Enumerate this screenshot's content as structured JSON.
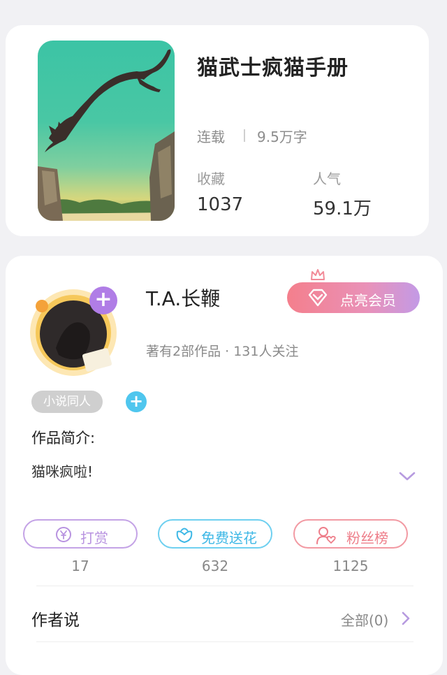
{
  "book": {
    "title": "猫武士疯猫手册",
    "status": "连载",
    "word_count": "9.5万字",
    "collect_label": "收藏",
    "collect_value": "1037",
    "popularity_label": "人气",
    "popularity_value": "59.1万"
  },
  "author": {
    "name": "T.A.长鞭",
    "vip_label": "点亮会员",
    "summary": "著有2部作品 · 131人关注",
    "tag": "小说同人"
  },
  "intro": {
    "title": "作品简介:",
    "text": "猫咪疯啦!"
  },
  "actions": [
    {
      "label": "打赏",
      "count": "17",
      "color": "#b893e0"
    },
    {
      "label": "免费送花",
      "count": "632",
      "color": "#55c7ee"
    },
    {
      "label": "粉丝榜",
      "count": "1125",
      "color": "#f08a92"
    }
  ],
  "author_says": {
    "title": "作者说",
    "all_label": "全部(0)"
  }
}
